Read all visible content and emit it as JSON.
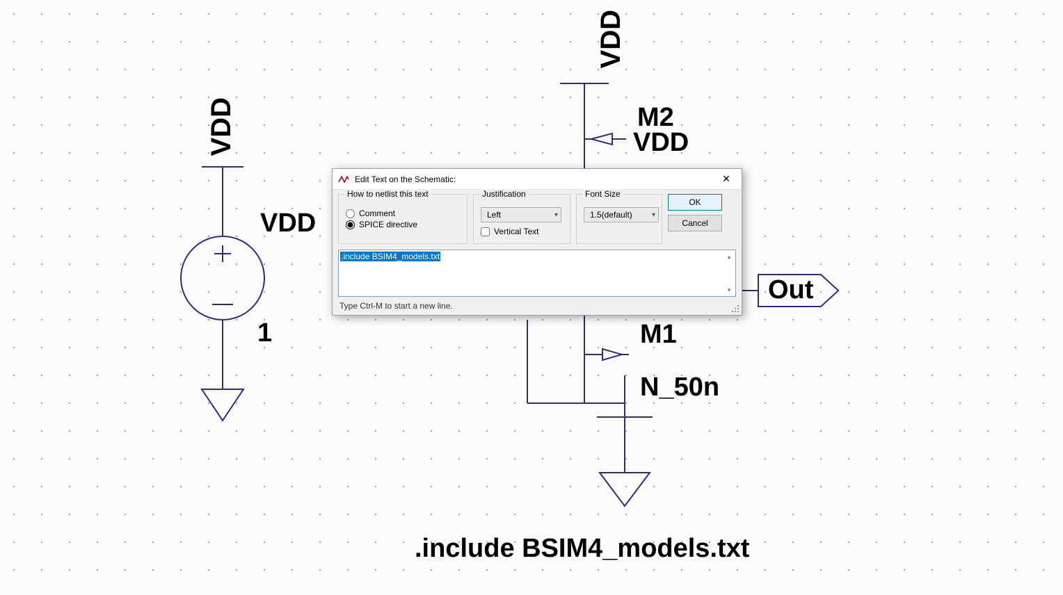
{
  "schematic": {
    "vsource": {
      "net_label": "VDD",
      "name": "VDD",
      "value": "1"
    },
    "top_vdd": "VDD",
    "m2": {
      "name": "M2",
      "body": "VDD"
    },
    "m1": {
      "name": "M1",
      "model": "N_50n"
    },
    "out_label": "Out",
    "directive": ".include BSIM4_models.txt"
  },
  "dialog": {
    "title": "Edit Text on the Schematic:",
    "group_netlist": "How to netlist this text",
    "opt_comment": "Comment",
    "opt_spice": "SPICE directive",
    "group_justification": "Justification",
    "just_value": "Left",
    "vertical_text": "Vertical Text",
    "group_fontsize": "Font Size",
    "font_value": "1.5(default)",
    "ok": "OK",
    "cancel": "Cancel",
    "text_value": ".include BSIM4_models.txt",
    "hint": "Type Ctrl-M to start a new line."
  }
}
